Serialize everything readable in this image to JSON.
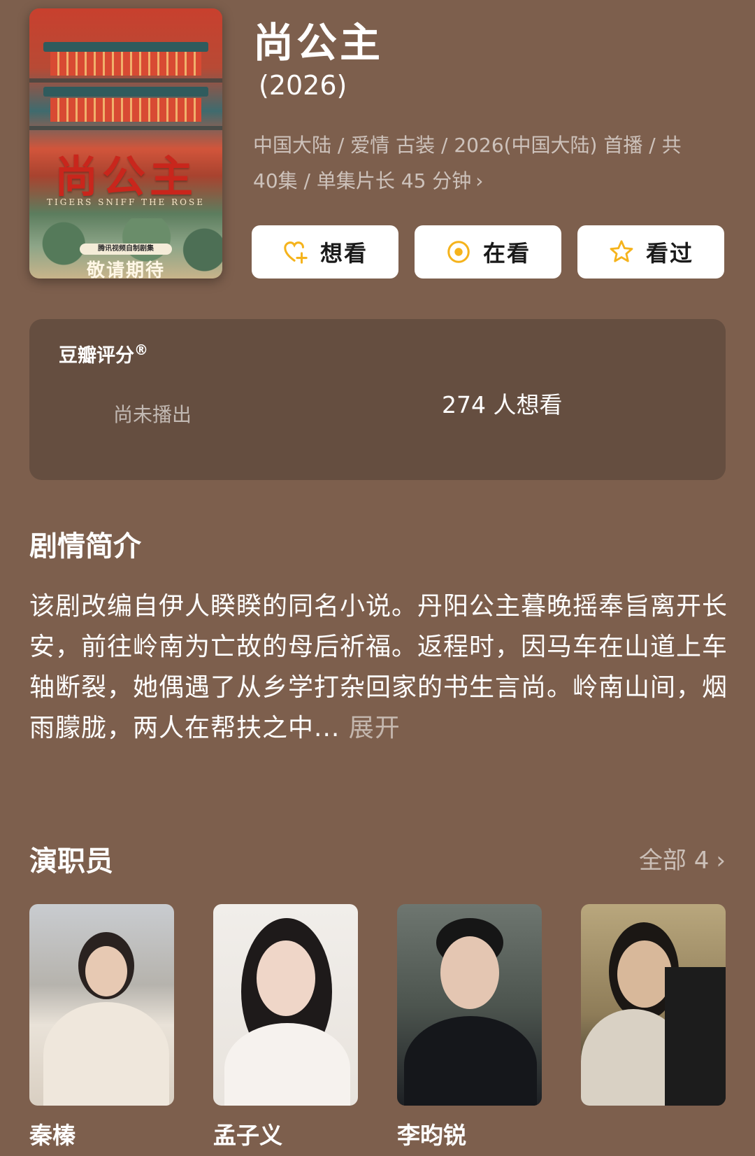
{
  "poster": {
    "title_art": "尚公主",
    "subtitle_art": "TIGERS SNIFF THE ROSE",
    "badge": "腾讯视频自制剧集",
    "coming": "敬请期待"
  },
  "header": {
    "title": "尚公主",
    "year": "(2026)",
    "meta_line1": "中国大陆 / 爱情 古装 / 2026(中国大陆) 首播 / 共",
    "meta_line2": "40集 / 单集片长 45 分钟"
  },
  "actions": [
    {
      "label": "想看",
      "icon": "heart-plus-icon"
    },
    {
      "label": "在看",
      "icon": "target-circle-icon"
    },
    {
      "label": "看过",
      "icon": "star-icon"
    }
  ],
  "colors": {
    "accent": "#f5b31c",
    "background": "#7d5f4d",
    "card": "#654e40"
  },
  "rating": {
    "label": "豆瓣评分",
    "mark": "®",
    "status": "尚未播出",
    "want_count": "274 人想看"
  },
  "synopsis": {
    "heading": "剧情简介",
    "text": "该剧改编自伊人睽睽的同名小说。丹阳公主暮晚摇奉旨离开长安，前往岭南为亡故的母后祈福。返程时，因马车在山道上车轴断裂，她偶遇了从乡学打杂回家的书生言尚。岭南山间，烟雨朦胧，两人在帮扶之中...",
    "expand": "展开"
  },
  "cast": {
    "heading": "演职员",
    "all_label": "全部 4",
    "members": [
      {
        "name": "秦榛"
      },
      {
        "name": "孟子义"
      },
      {
        "name": "李昀锐"
      },
      {
        "name": ""
      }
    ]
  }
}
